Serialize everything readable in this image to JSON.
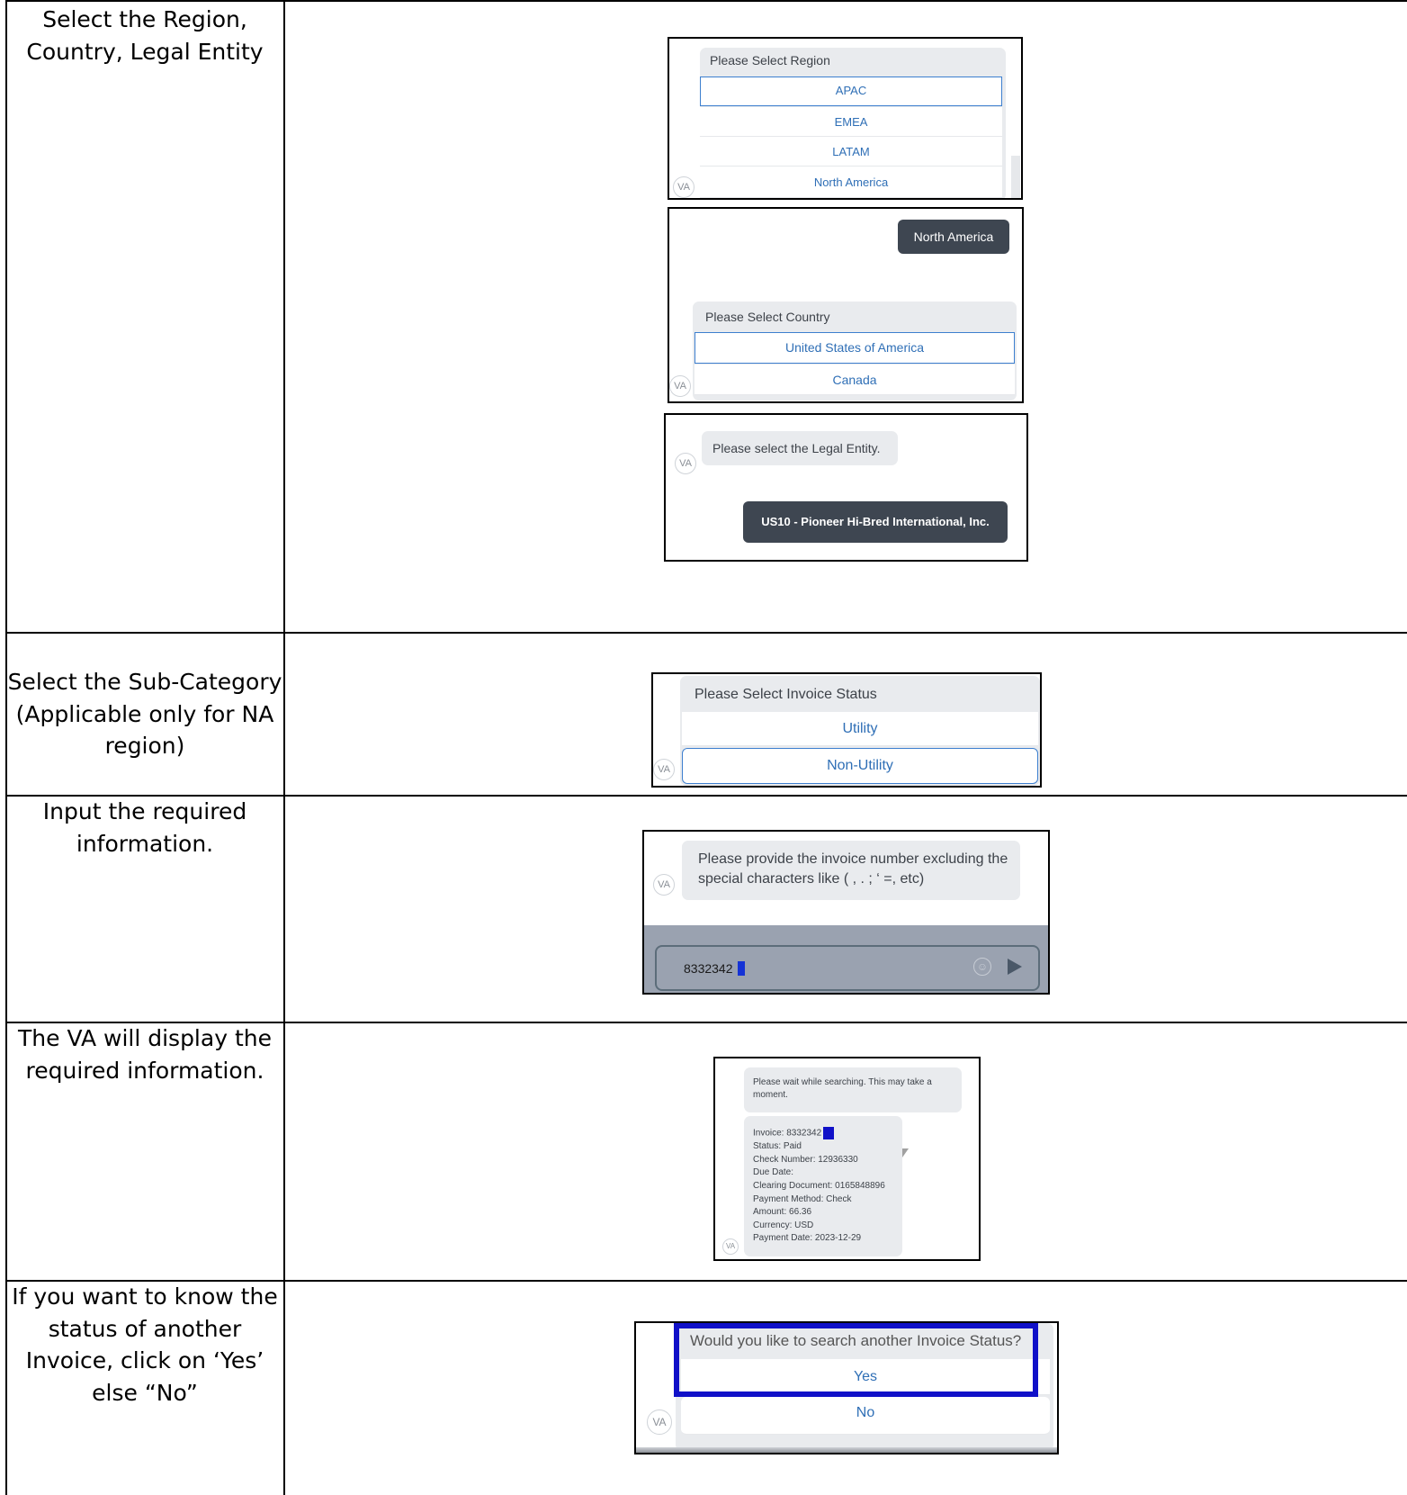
{
  "steps": [
    {
      "label": "Select the Region, Country, Legal Entity"
    },
    {
      "label": "Select the Sub-Category (Applicable only for NA region)"
    },
    {
      "label": "Input the required information."
    },
    {
      "label": "The VA will display the required information."
    },
    {
      "label": "If you want to know the status of another Invoice, click on ‘Yes’ else “No”"
    }
  ],
  "avatar_label": "VA",
  "region": {
    "prompt": "Please Select Region",
    "options": [
      "APAC",
      "EMEA",
      "LATAM",
      "North America"
    ],
    "selected": "APAC"
  },
  "country": {
    "user_reply": "North America",
    "prompt": "Please Select Country",
    "options": [
      "United States of America",
      "Canada"
    ],
    "selected": "United States of America"
  },
  "legal_entity": {
    "prompt": "Please select the Legal Entity.",
    "user_reply": "US10 - Pioneer Hi-Bred International, Inc."
  },
  "sub_category": {
    "prompt": "Please Select Invoice Status",
    "options": [
      "Utility",
      "Non-Utility"
    ],
    "selected": "Non-Utility"
  },
  "invoice_input": {
    "prompt": "Please provide the invoice number excluding the special characters like ( , . ; ‘ =, etc)",
    "value": "8332342",
    "emoji_icon": "smiley-icon",
    "send_icon": "send-arrow-icon"
  },
  "result": {
    "wait_message": "Please wait while searching. This may take a moment.",
    "lines": [
      "Invoice: 8332342",
      "Status: Paid",
      "Check Number: 12936330",
      "Due Date:",
      "Clearing Document: 0165848896",
      "Payment Method: Check",
      "Amount: 66.36",
      "Currency: USD",
      "Payment Date: 2023-12-29"
    ]
  },
  "search_again": {
    "prompt": "Would you like to search another Invoice Status?",
    "options": [
      "Yes",
      "No"
    ],
    "highlighted": "Yes"
  },
  "colors": {
    "link_blue": "#2f6fb6",
    "dark_bubble": "#3e4651",
    "highlight_blue": "#1010c8"
  }
}
